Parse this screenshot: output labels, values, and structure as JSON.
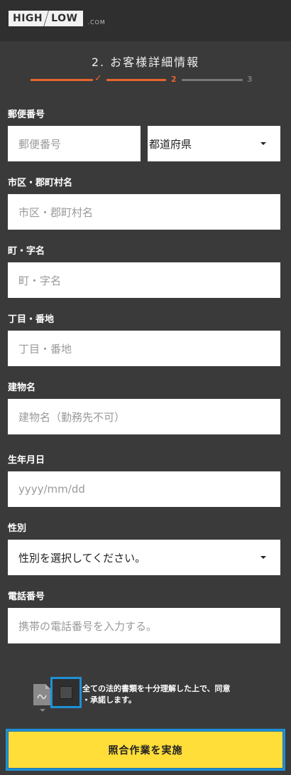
{
  "brand": {
    "high": "HIGH",
    "low": "LOW",
    "domain": ".COM"
  },
  "step": {
    "title": "2. お客様詳細情報",
    "current": 2,
    "total": 3,
    "check_mark": "✓",
    "num_current": "2",
    "num_next": "3"
  },
  "colors": {
    "accent": "#e8642d",
    "inactive": "#777777",
    "focus": "#1e90d6",
    "button": "#ffde3a"
  },
  "form": {
    "postal_label": "郵便番号",
    "postal_placeholder": "郵便番号",
    "prefecture_value": "都道府県",
    "city_label": "市区・郡町村名",
    "city_placeholder": "市区・郡町村名",
    "town_label": "町・字名",
    "town_placeholder": " 町・字名",
    "chome_label": "丁目・番地",
    "chome_placeholder": "丁目・番地",
    "building_label": "建物名",
    "building_placeholder": " 建物名（勤務先不可）",
    "birth_label": "生年月日",
    "birth_placeholder": "yyyy/mm/dd",
    "gender_label": "性別",
    "gender_value": "性別を選択してください。",
    "phone_label": "電話番号",
    "phone_placeholder": "携帯の電話番号を入力する。"
  },
  "consent": {
    "text_line1": "全ての法的書類を十分理解した上で、同意",
    "text_line2": "・承諾します。",
    "pdf_icon": "pdf-document-icon"
  },
  "submit_label": "照合作業を実施"
}
